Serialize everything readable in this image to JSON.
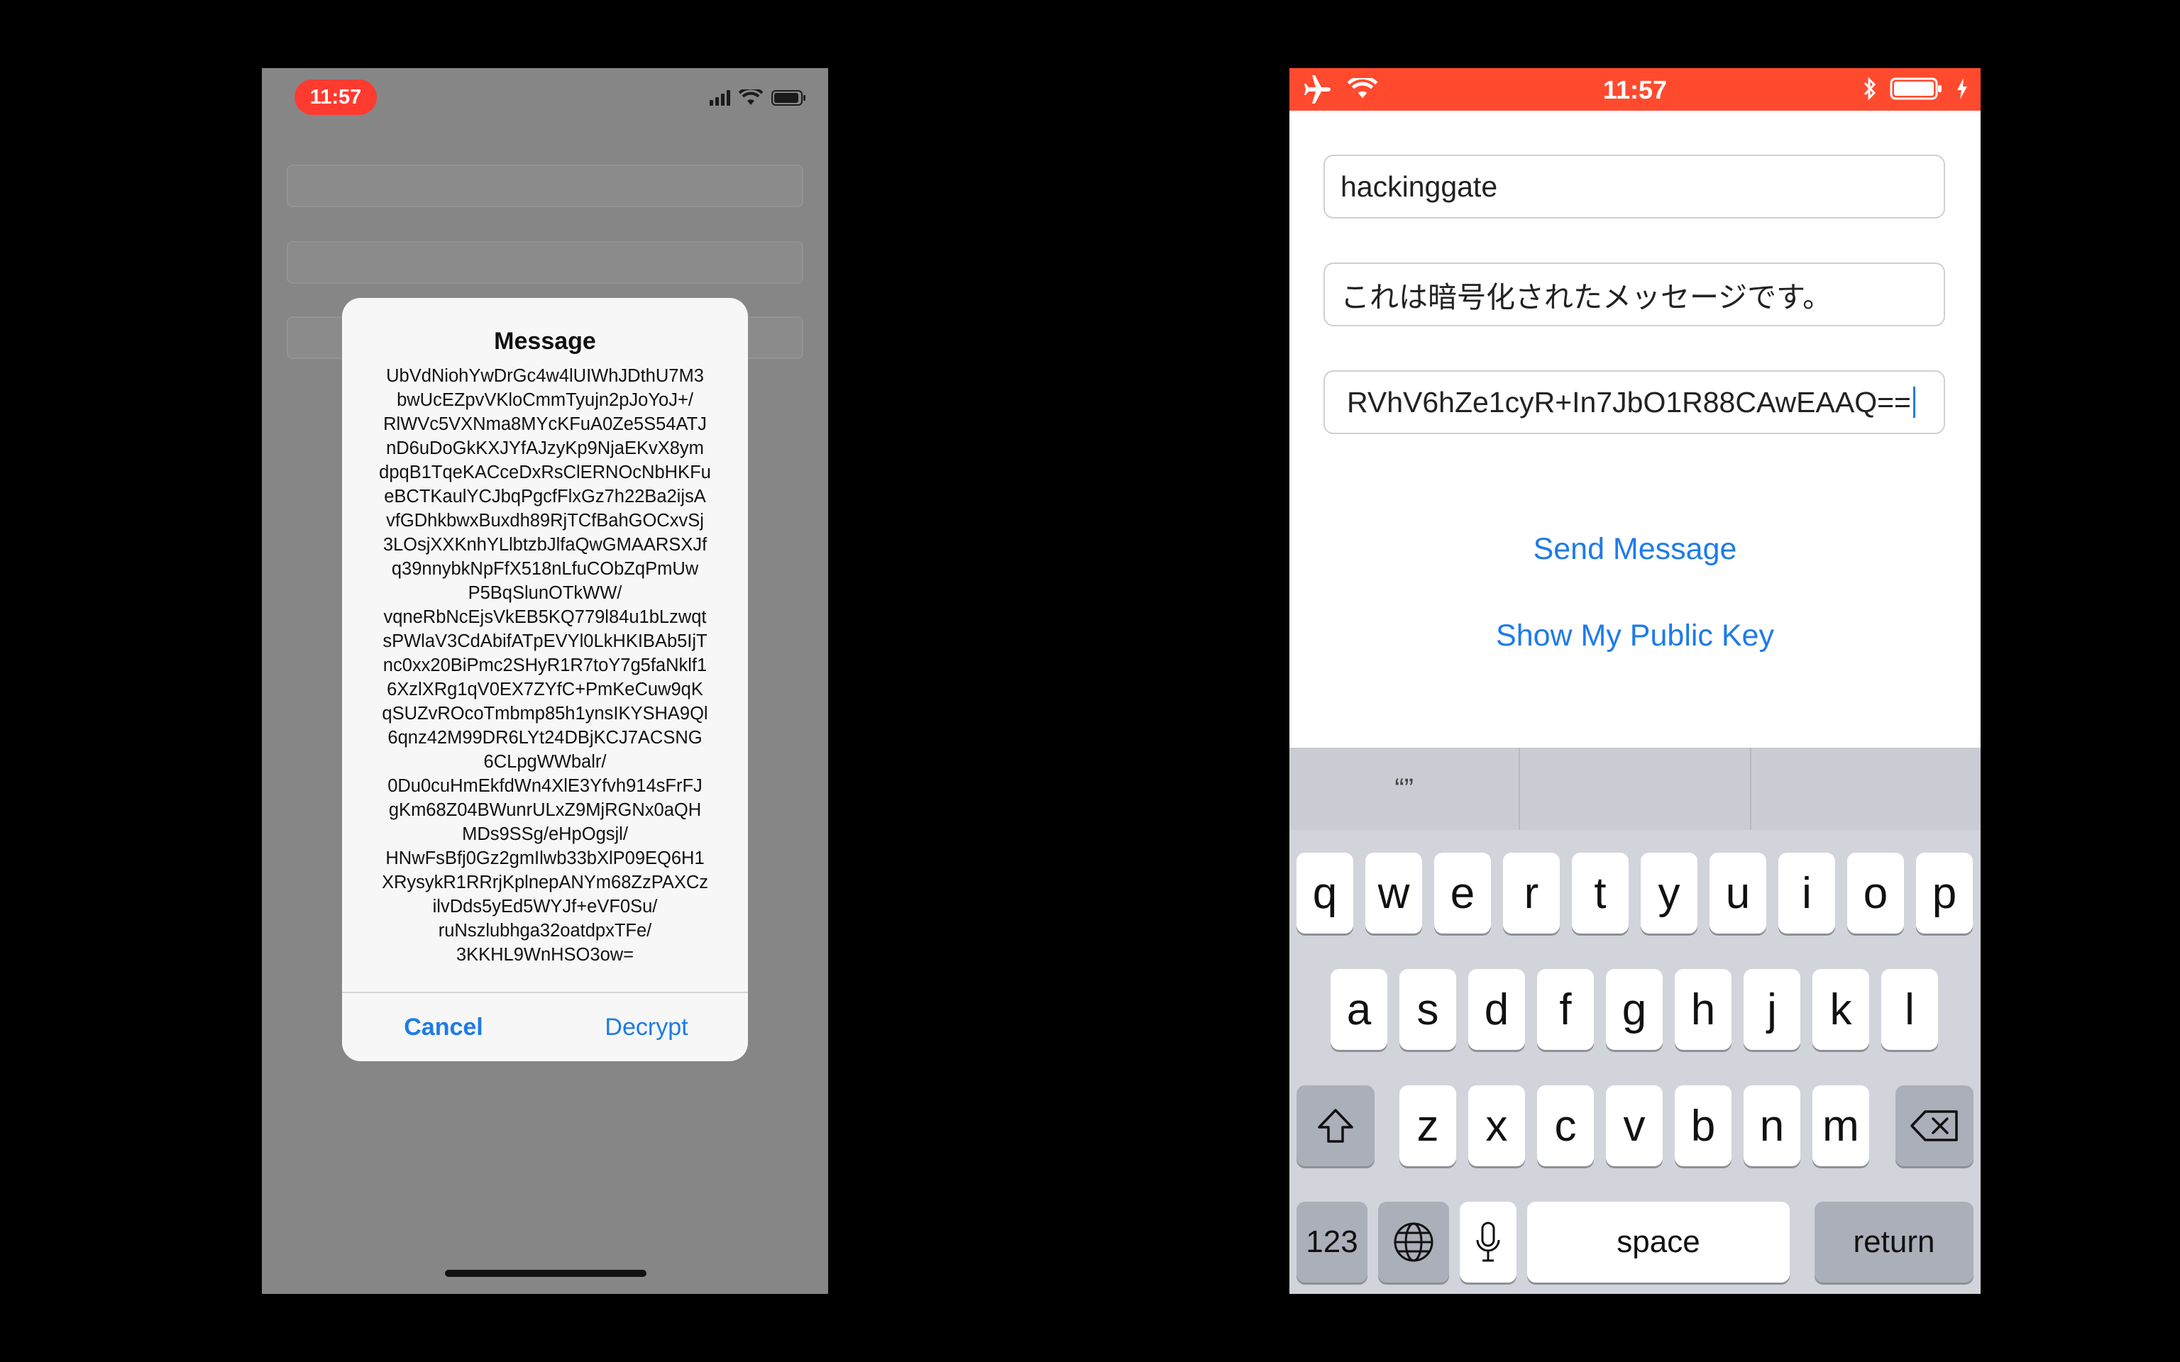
{
  "left_phone": {
    "status_time": "11:57",
    "alert": {
      "title": "Message",
      "body": "UbVdNiohYwDrGc4w4lUIWhJDthU7M3\nbwUcEZpvVKloCmmTyujn2pJoYoJ+/\nRlWVc5VXNma8MYcKFuA0Ze5S54ATJ\nnD6uDoGkKXJYfAJzyKp9NjaEKvX8ym\ndpqB1TqeKACceDxRsClERNOcNbHKFu\neBCTKaulYCJbqPgcfFlxGz7h22Ba2ijsA\nvfGDhkbwxBuxdh89RjTCfBahGOCxvSj\n3LOsjXXKnhYLlbtzbJlfaQwGMAARSXJf\nq39nnybkNpFfX518nLfuCObZqPmUw\nP5BqSlunOTkWW/\nvqneRbNcEjsVkEB5KQ779l84u1bLzwqt\nsPWlaV3CdAbifATpEVYl0LkHKIBAb5IjT\nnc0xx20BiPmc2SHyR1R7toY7g5faNklf1\n6XzlXRg1qV0EX7ZYfC+PmKeCuw9qK\nqSUZvROcoTmbmp85h1ynsIKYSHA9Ql\n6qnz42M99DR6LYt24DBjKCJ7ACSNG\n6CLpgWWbalr/\n0Du0cuHmEkfdWn4XlE3Yfvh914sFrFJ\ngKm68Z04BWunrULxZ9MjRGNx0aQH\nMDs9SSg/eHpOgsjl/\nHNwFsBfj0Gz2gmIlwb33bXlP09EQ6H1\nXRysykR1RRrjKplnepANYm68ZzPAXCz\nilvDds5yEd5WYJf+eVF0Su/\nruNszlubhga32oatdpxTFe/\n3KKHL9WnHSO3ow=",
      "cancel_label": "Cancel",
      "decrypt_label": "Decrypt"
    }
  },
  "right_phone": {
    "status_time": "11:57",
    "fields": {
      "username": "hackinggate",
      "message": "これは暗号化されたメッセージです。",
      "encrypted": "RVhV6hZe1cyR+In7JbO1R88CAwEAAQ=="
    },
    "buttons": {
      "send": "Send Message",
      "show_key": "Show My Public Key"
    },
    "keyboard": {
      "suggestions": [
        "“”",
        "",
        ""
      ],
      "row1": [
        "q",
        "w",
        "e",
        "r",
        "t",
        "y",
        "u",
        "i",
        "o",
        "p"
      ],
      "row2": [
        "a",
        "s",
        "d",
        "f",
        "g",
        "h",
        "j",
        "k",
        "l"
      ],
      "row3": [
        "z",
        "x",
        "c",
        "v",
        "b",
        "n",
        "m"
      ],
      "numbers_label": "123",
      "space_label": "space",
      "return_label": "return"
    }
  },
  "colors": {
    "accent": "#1e7be8",
    "status_red": "#ff3b30",
    "status_orange": "#ff4a2e"
  }
}
